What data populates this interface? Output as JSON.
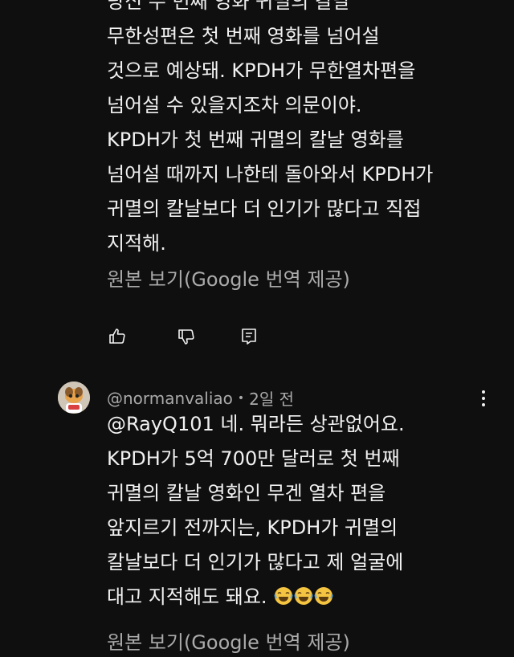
{
  "comment1": {
    "text": "당신 수 번째 영화 귀멸의 칼날\n무한성편은 첫 번째 영화를 넘어설\n것으로 예상돼. KPDH가 무한열차편을\n넘어설 수 있을지조차 의문이야.\nKPDH가 첫 번째 귀멸의 칼날 영화를\n넘어설 때까지 나한테 돌아와서 KPDH가\n귀멸의 칼날보다 더 인기가 많다고 직접\n지적해.",
    "translate_label": "원본 보기(Google 번역 제공)",
    "actions": {
      "like_icon": "thumbs-up-icon",
      "dislike_icon": "thumbs-down-icon",
      "reply_icon": "reply-comment-icon"
    }
  },
  "comment2": {
    "author": "@normanvaliao",
    "time": "2일 전",
    "avatar_icon": "cartoon-avatar",
    "menu_icon": "more-vertical-icon",
    "text": "@RayQ101 네. 뭐라든 상관없어요.\nKPDH가 5억 700만 달러로 첫 번째\n귀멸의 칼날 영화인 무겐 열차 편을\n앞지르기 전까지는, KPDH가 귀멸의\n칼날보다 더 인기가 많다고 제 얼굴에\n대고 지적해도 돼요. ",
    "emoji": [
      "😂",
      "😂",
      "😂"
    ],
    "translate_label": "원본 보기(Google 번역 제공)"
  },
  "colors": {
    "background": "#0f0f0f",
    "text": "#f1f1f1",
    "secondary": "#aaaaaa",
    "emoji": "#f5c542"
  }
}
